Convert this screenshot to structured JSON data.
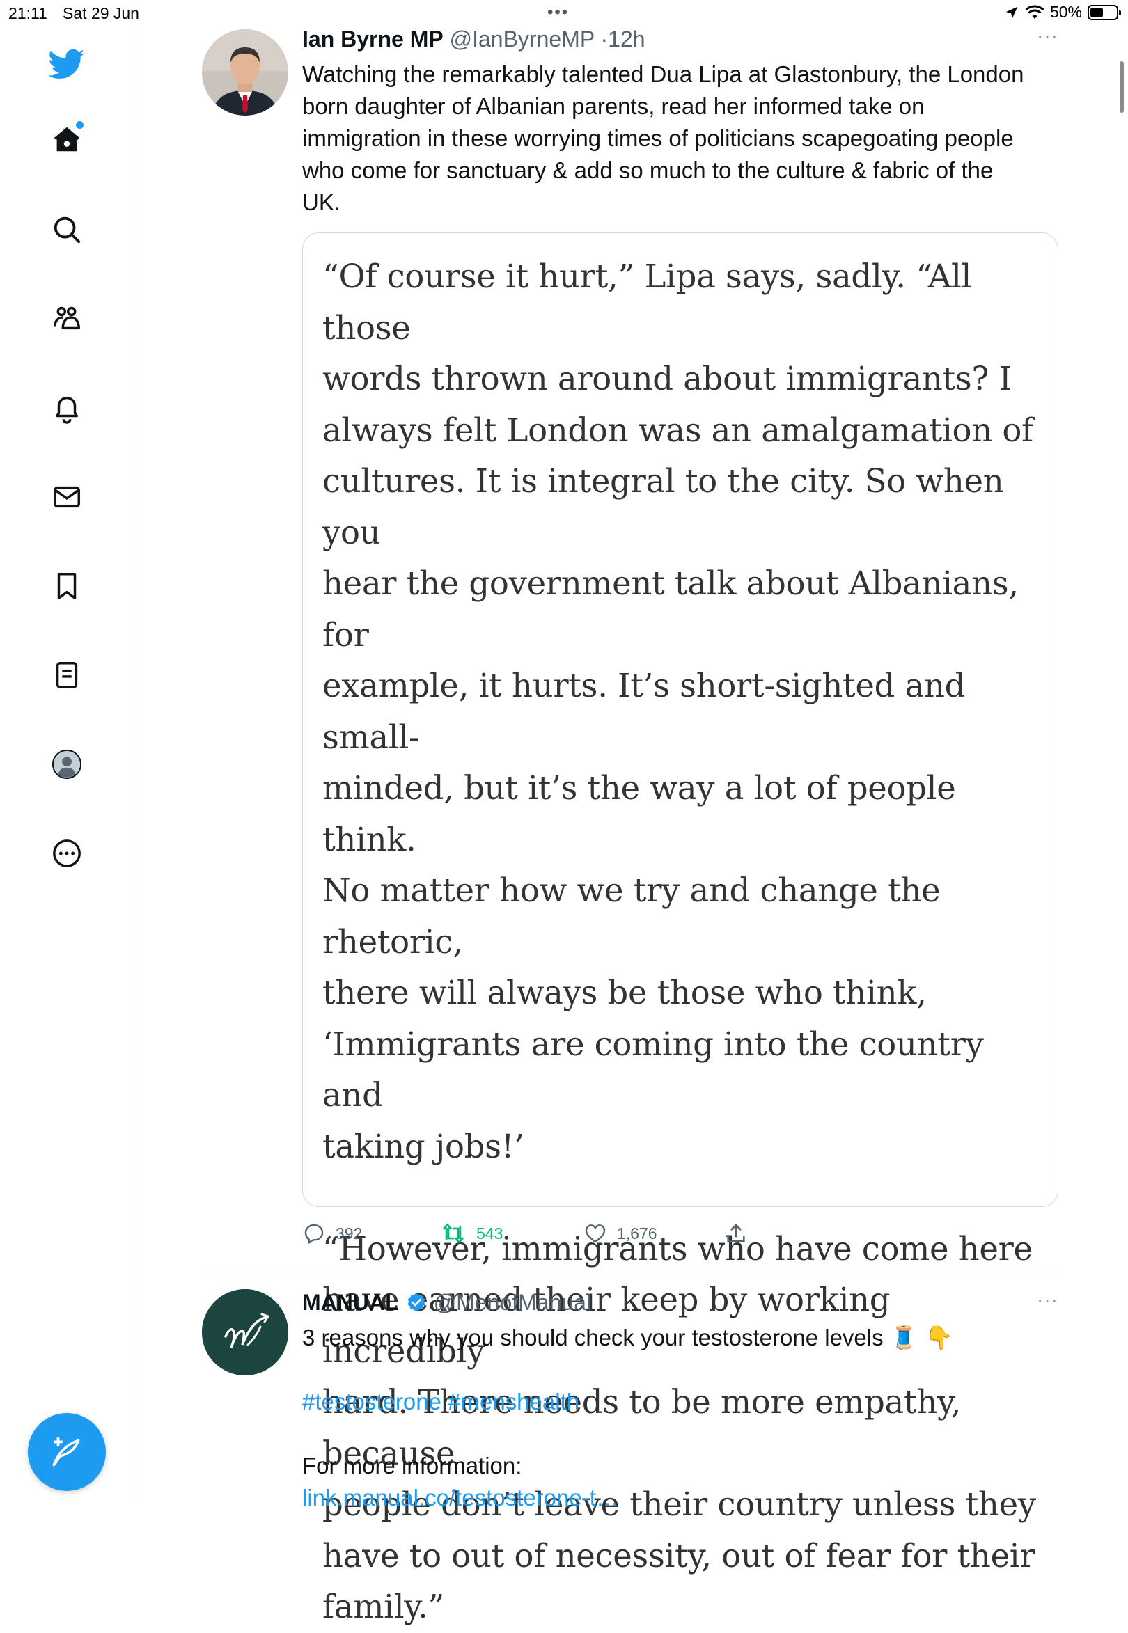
{
  "status_bar": {
    "time": "21:11",
    "date": "Sat 29 Jun",
    "battery": "50%",
    "battery_level": 0.5
  },
  "sidebar": {
    "items": [
      {
        "icon": "twitter-bird-icon"
      },
      {
        "icon": "home-icon",
        "has_notification_dot": true
      },
      {
        "icon": "search-icon"
      },
      {
        "icon": "communities-icon"
      },
      {
        "icon": "notifications-bell-icon"
      },
      {
        "icon": "messages-envelope-icon"
      },
      {
        "icon": "bookmark-icon"
      },
      {
        "icon": "lists-icon"
      },
      {
        "icon": "profile-avatar-icon"
      },
      {
        "icon": "more-circle-icon"
      }
    ],
    "compose_icon": "compose-tweet-icon"
  },
  "colors": {
    "accent": "#1d9bf0",
    "retweet_green": "#00ba7c",
    "muted": "#536471"
  },
  "tweets": [
    {
      "name": "Ian Byrne MP",
      "handle": "@IanByrneMP",
      "separator": "·",
      "time_ago": "12h",
      "more": "···",
      "text_lines": [
        "Watching the remarkably talented Dua Lipa at Glastonbury, the London",
        "born daughter of Albanian parents, read her informed take on",
        "immigration in these worrying times of politicians scapegoating people",
        "who come for sanctuary & add so much to the culture & fabric of the",
        "UK."
      ],
      "image_quote_lines": [
        "“Of course it hurt,” Lipa says, sadly. “All those",
        "words thrown around about immigrants? I",
        "always felt London was an amalgamation of",
        "cultures. It is integral to the city. So when you",
        "hear the government talk about Albanians, for",
        "example, it hurts. It’s short-sighted and small-",
        "minded, but it’s the way a lot of people think.",
        "No matter how we try and change the rhetoric,",
        "there will always be those who think,",
        "‘Immigrants are coming into the country and",
        "taking jobs!’",
        "",
        "“However, immigrants who have come here",
        "have earned their keep by working incredibly",
        "hard. There needs to be more empathy, because",
        "people don’t leave their country unless they",
        "have to out of necessity, out of fear for their",
        "family.”"
      ],
      "replies": "392",
      "retweets": "543",
      "retweeted": true,
      "likes": "1,676"
    },
    {
      "name": "MANUAL",
      "verified": true,
      "handle": "@MenofManual",
      "more": "···",
      "text": "3 reasons why you should check your testosterone levels",
      "emojis": "🧵 👇",
      "hashtags": "#testosterone #menshealth",
      "info_label": "For more information:",
      "link": "link.manual.co/testosterone-t…"
    }
  ]
}
